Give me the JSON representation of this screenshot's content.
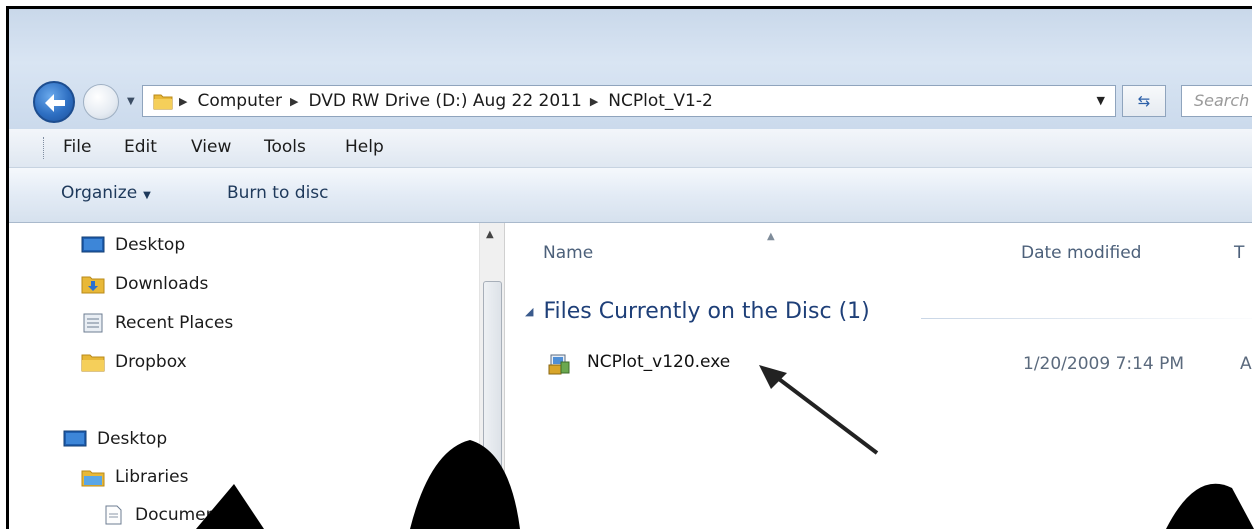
{
  "navigation": {
    "back_label": "Back",
    "forward_label": "Forward",
    "breadcrumbs": [
      "Computer",
      "DVD RW Drive (D:) Aug 22 2011",
      "NCPlot_V1-2"
    ],
    "search_placeholder": "Search"
  },
  "menu": {
    "items": [
      "File",
      "Edit",
      "View",
      "Tools",
      "Help"
    ]
  },
  "commands": {
    "organize_label": "Organize",
    "burn_label": "Burn to disc"
  },
  "sidebar": {
    "items": [
      {
        "label": "Desktop",
        "icon": "desktop-icon"
      },
      {
        "label": "Downloads",
        "icon": "downloads-folder-icon"
      },
      {
        "label": "Recent Places",
        "icon": "recent-places-icon"
      },
      {
        "label": "Dropbox",
        "icon": "folder-icon"
      },
      {
        "label": "Desktop",
        "icon": "desktop-icon"
      },
      {
        "label": "Libraries",
        "icon": "libraries-icon"
      },
      {
        "label": "Documents",
        "icon": "document-icon"
      }
    ]
  },
  "content": {
    "columns": {
      "name": "Name",
      "date": "Date modified",
      "type": "T"
    },
    "group_title": "Files Currently on the Disc (1)",
    "files": [
      {
        "name": "NCPlot_v120.exe",
        "date_modified": "1/20/2009 7:14 PM",
        "type_partial": "A"
      }
    ]
  },
  "colors": {
    "title_band": "#cbdaec",
    "group_title": "#1e3f78",
    "watermark": "#000000"
  }
}
